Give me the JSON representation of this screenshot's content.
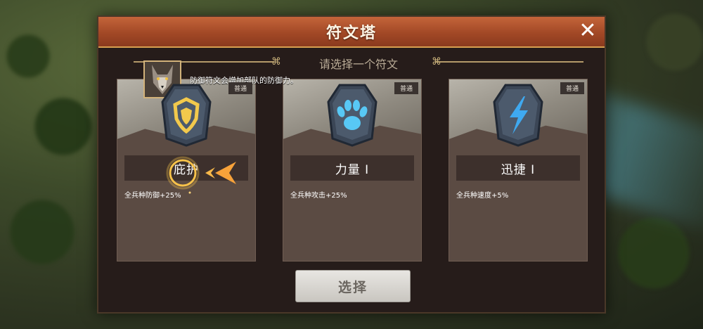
{
  "dialog": {
    "title": "符文塔",
    "subtitle": "请选择一个符文",
    "close_icon": "close-icon",
    "hint": "防御符文会增加部队的防御力。",
    "select_button": "选择"
  },
  "runes": [
    {
      "name": "庇护",
      "rarity": "普通",
      "effect": "全兵种防御+25%",
      "icon": "shield-rune-icon",
      "color": "#f2c94c"
    },
    {
      "name": "力量 I",
      "rarity": "普通",
      "effect": "全兵种攻击+25%",
      "icon": "paw-rune-icon",
      "color": "#58c8f5"
    },
    {
      "name": "迅捷 I",
      "rarity": "普通",
      "effect": "全兵种速度+5%",
      "icon": "lightning-rune-icon",
      "color": "#3fa9f0"
    }
  ]
}
